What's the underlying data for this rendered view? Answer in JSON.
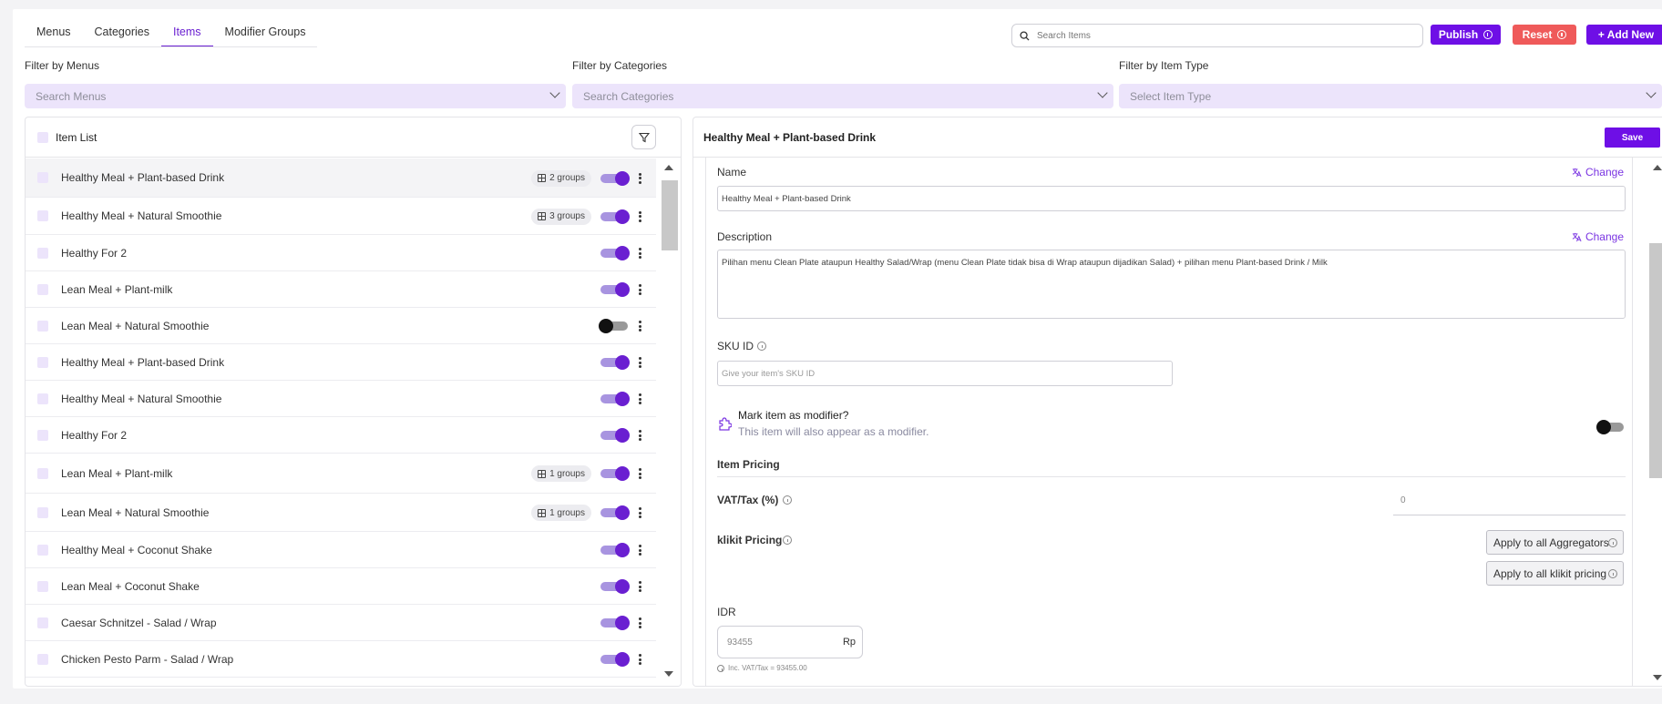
{
  "tabs": [
    "Menus",
    "Categories",
    "Items",
    "Modifier Groups"
  ],
  "active_tab": "Items",
  "search": {
    "placeholder": "Search Items"
  },
  "buttons": {
    "publish": "Publish",
    "reset": "Reset",
    "add_new": "+ Add New"
  },
  "filters": {
    "menus": {
      "label": "Filter by Menus",
      "placeholder": "Search Menus"
    },
    "categories": {
      "label": "Filter by Categories",
      "placeholder": "Search Categories"
    },
    "item_type": {
      "label": "Filter by Item Type",
      "placeholder": "Select Item Type"
    }
  },
  "item_list": {
    "header": "Item List",
    "items": [
      {
        "name": "Healthy Meal + Plant-based Drink",
        "groups": "2 groups",
        "enabled": true,
        "visible_icon": true
      },
      {
        "name": "Healthy Meal + Natural Smoothie",
        "groups": "3 groups",
        "enabled": true
      },
      {
        "name": "Healthy For 2",
        "groups": "",
        "enabled": true
      },
      {
        "name": "Lean Meal + Plant-milk",
        "groups": "",
        "enabled": true
      },
      {
        "name": "Lean Meal + Natural Smoothie",
        "groups": "",
        "enabled": false
      },
      {
        "name": "Healthy Meal + Plant-based Drink",
        "groups": "",
        "enabled": true
      },
      {
        "name": "Healthy Meal + Natural Smoothie",
        "groups": "",
        "enabled": true
      },
      {
        "name": "Healthy For 2",
        "groups": "",
        "enabled": true
      },
      {
        "name": "Lean Meal + Plant-milk",
        "groups": "1 groups",
        "enabled": true
      },
      {
        "name": "Lean Meal + Natural Smoothie",
        "groups": "1 groups",
        "enabled": true
      },
      {
        "name": "Healthy Meal + Coconut Shake",
        "groups": "",
        "enabled": true
      },
      {
        "name": "Lean Meal + Coconut Shake",
        "groups": "",
        "enabled": true
      },
      {
        "name": "Caesar Schnitzel - Salad / Wrap",
        "groups": "",
        "enabled": true
      },
      {
        "name": "Chicken Pesto Parm - Salad / Wrap",
        "groups": "",
        "enabled": true
      }
    ]
  },
  "detail": {
    "title": "Healthy Meal + Plant-based Drink",
    "save_label": "Save",
    "change_label": "Change",
    "name_label": "Name",
    "name_value": "Healthy Meal + Plant-based Drink",
    "description_label": "Description",
    "description_value": "Pilihan menu Clean Plate ataupun Healthy Salad/Wrap (menu Clean Plate tidak bisa di Wrap ataupun dijadikan Salad) + pilihan menu Plant-based Drink / Milk",
    "sku_label": "SKU ID",
    "sku_placeholder": "Give your item's SKU ID",
    "modifier_title": "Mark item as modifier?",
    "modifier_subtitle": "This item will also appear as a modifier.",
    "pricing_title": "Item Pricing",
    "vat_label": "VAT/Tax (%)",
    "vat_value": "0",
    "klikit_label": "klikit Pricing",
    "apply_aggregators": "Apply to all Aggregators",
    "apply_klikit": "Apply to all klikit pricing",
    "currency_label": "IDR",
    "price_value": "93455",
    "currency_symbol": "Rp",
    "inc_vat_note": "Inc. VAT/Tax = 93455.00"
  },
  "colors": {
    "accent": "#6e0fe6",
    "reset": "#ef5a5a",
    "filter_bg": "#ece4fb"
  }
}
